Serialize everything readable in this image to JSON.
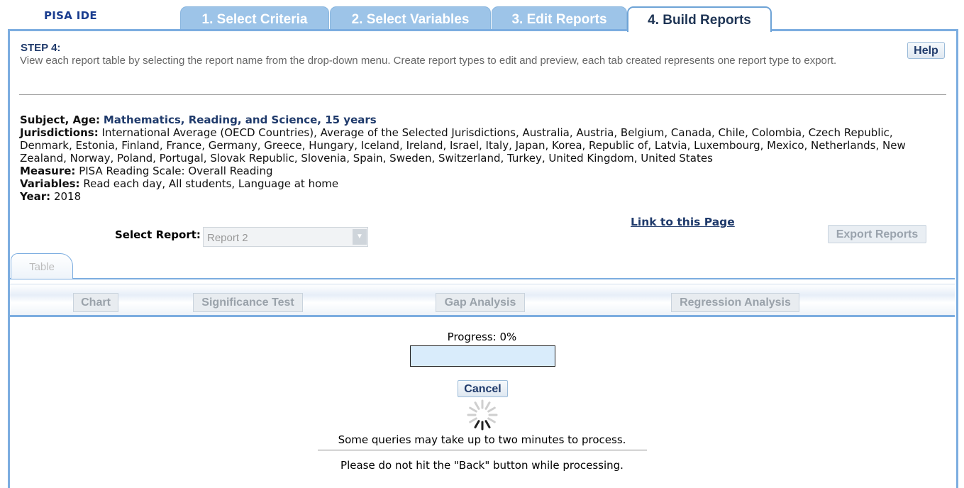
{
  "app": {
    "logo": "PISA IDE"
  },
  "tabs": [
    {
      "label": "1. Select Criteria",
      "active": false
    },
    {
      "label": "2. Select Variables",
      "active": false
    },
    {
      "label": "3. Edit Reports",
      "active": false
    },
    {
      "label": "4. Build Reports",
      "active": true
    }
  ],
  "step": {
    "title": "STEP 4:",
    "description": "View each report table by selecting the report name from the drop-down menu. Create report types to edit and preview, each tab created represents one report type to export.",
    "help_label": "Help"
  },
  "info": {
    "subject_label": "Subject, Age:",
    "subject_value": "Mathematics, Reading, and Science, 15 years",
    "jurisdictions_label": "Jurisdictions:",
    "jurisdictions_value": "International Average (OECD Countries), Average of the Selected Jurisdictions, Australia, Austria, Belgium, Canada, Chile, Colombia, Czech Republic, Denmark, Estonia, Finland, France, Germany, Greece, Hungary, Iceland, Ireland, Israel, Italy, Japan, Korea, Republic of, Latvia, Luxembourg, Mexico, Netherlands, New Zealand, Norway, Poland, Portugal, Slovak Republic, Slovenia, Spain, Sweden, Switzerland, Turkey, United Kingdom, United States",
    "measure_label": "Measure:",
    "measure_value": "PISA Reading Scale: Overall Reading",
    "variables_label": "Variables:",
    "variables_value": "Read each day, All students, Language at home",
    "year_label": "Year:",
    "year_value": "2018"
  },
  "controls": {
    "link_to_page": "Link to this Page",
    "export_reports": "Export Reports",
    "select_report_label": "Select Report:",
    "select_report_value": "Report 2"
  },
  "sub_tab": {
    "label": "Table"
  },
  "toolbar": {
    "chart": "Chart",
    "significance_test": "Significance Test",
    "gap_analysis": "Gap Analysis",
    "regression_analysis": "Regression Analysis"
  },
  "progress": {
    "label": "Progress: 0%",
    "value": 0,
    "cancel_label": "Cancel",
    "message_1": "Some queries may take up to two minutes to process.",
    "message_2": "Please do not hit the \"Back\" button while processing."
  },
  "colors": {
    "accent": "#7cade0",
    "tab_inactive": "#9dc4e8",
    "title_blue": "#1f3a6b"
  }
}
